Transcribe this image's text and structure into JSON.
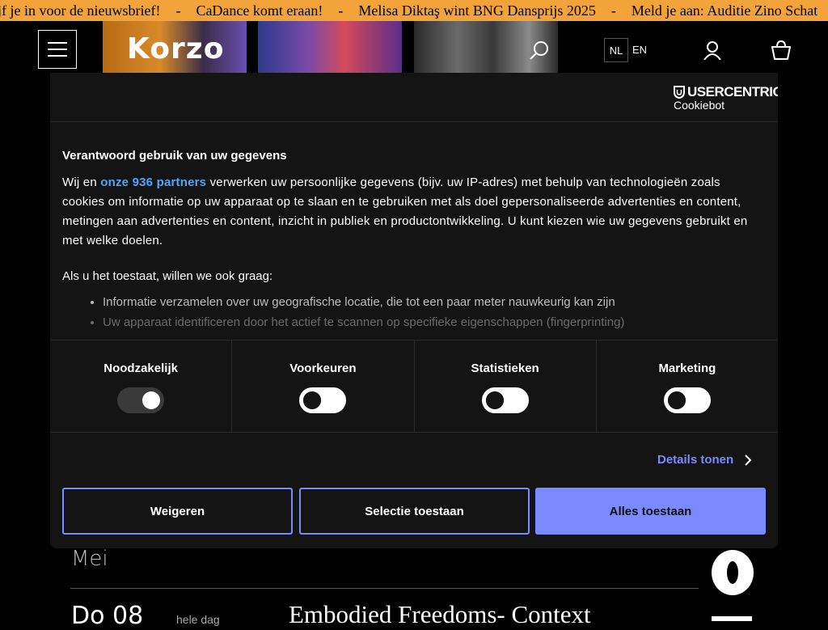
{
  "ticker": {
    "items": [
      "ijf je in voor de nieuwsbrief!",
      "CaDance komt eraan!",
      "Melisa Diktaş wint BNG Dansprijs 2025",
      "Meld je aan: Auditie Zino Schat"
    ],
    "separator": "-"
  },
  "header": {
    "logo": "Korzo",
    "lang_nl": "NL",
    "lang_en": "EN"
  },
  "listing": {
    "row1_month": "Mei",
    "row2_date": "Do 08",
    "row2_time": "hele dag",
    "row2_title": "Embodied Freedoms- Context",
    "side_glyph": "o"
  },
  "dialog": {
    "brand_main": "USERCENTRICS",
    "brand_sub": "Cookiebot",
    "title": "Verantwoord gebruik van uw gegevens",
    "para_prefix": "Wij en ",
    "partners_link": "onze 936 partners",
    "para_suffix": " verwerken uw persoonlijke gegevens (bijv. uw IP-adres) met behulp van technologieën zoals cookies om informatie op uw apparaat op te slaan en te gebruiken met als doel gepersonaliseerde advertenties en content, metingen aan advertenties en content, inzicht in publiek en productontwikkeling. U kunt kiezen wie uw gegevens gebruikt en met welke doelen.",
    "intro": "Als u het toestaat, willen we ook graag:",
    "list": [
      "Informatie verzamelen over uw geografische locatie, die tot een paar meter nauwkeurig kan zijn",
      "Uw apparaat identificeren door het actief te scannen op specifieke eigenschappen (fingerprinting)"
    ],
    "toggles": [
      {
        "label": "Noodzakelijk",
        "state": "on-disabled"
      },
      {
        "label": "Voorkeuren",
        "state": "off"
      },
      {
        "label": "Statistieken",
        "state": "off"
      },
      {
        "label": "Marketing",
        "state": "off"
      }
    ],
    "details_label": "Details tonen",
    "btn_deny": "Weigeren",
    "btn_select": "Selectie toestaan",
    "btn_all": "Alles toestaan",
    "accent_color": "#7b8bff",
    "link_color": "#4aa8ff"
  }
}
